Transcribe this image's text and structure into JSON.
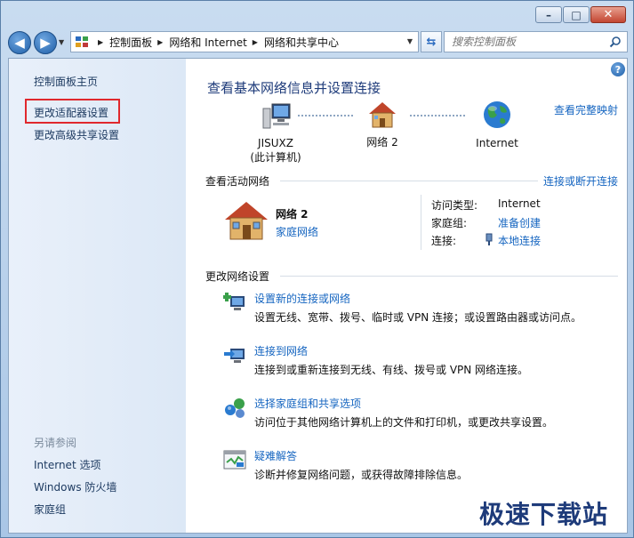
{
  "window": {
    "controls": {
      "minimize": "–",
      "maximize": "□",
      "close": "✕"
    }
  },
  "address_bar": {
    "breadcrumbs": [
      "控制面板",
      "网络和 Internet",
      "网络和共享中心"
    ]
  },
  "search": {
    "placeholder": "搜索控制面板"
  },
  "left_pane": {
    "links": [
      "控制面板主页",
      "更改适配器设置",
      "更改高级共享设置"
    ],
    "see_also_title": "另请参阅",
    "see_also": [
      "Internet 选项",
      "Windows 防火墙",
      "家庭组"
    ]
  },
  "main": {
    "title": "查看基本网络信息并设置连接",
    "full_map_link": "查看完整映射",
    "map": {
      "computer_name": "JISUXZ",
      "computer_sub": "(此计算机)",
      "network_name": "网络  2",
      "internet": "Internet"
    },
    "active_networks": {
      "header": "查看活动网络",
      "connect_link": "连接或断开连接",
      "network_name": "网络  2",
      "network_type": "家庭网络",
      "access_type_label": "访问类型:",
      "access_type_value": "Internet",
      "homegroup_label": "家庭组:",
      "homegroup_value": "准备创建",
      "connection_label": "连接:",
      "connection_value": "本地连接"
    },
    "change_settings": {
      "header": "更改网络设置",
      "tasks": [
        {
          "title": "设置新的连接或网络",
          "desc": "设置无线、宽带、拨号、临时或 VPN 连接；或设置路由器或访问点。"
        },
        {
          "title": "连接到网络",
          "desc": "连接到或重新连接到无线、有线、拨号或 VPN 网络连接。"
        },
        {
          "title": "选择家庭组和共享选项",
          "desc": "访问位于其他网络计算机上的文件和打印机，或更改共享设置。"
        },
        {
          "title": "疑难解答",
          "desc": "诊断并修复网络问题，或获得故障排除信息。"
        }
      ]
    }
  },
  "watermark": "极速下载站",
  "colors": {
    "link": "#1565c0",
    "title": "#1e3b7a",
    "highlight": "#e0282d"
  }
}
